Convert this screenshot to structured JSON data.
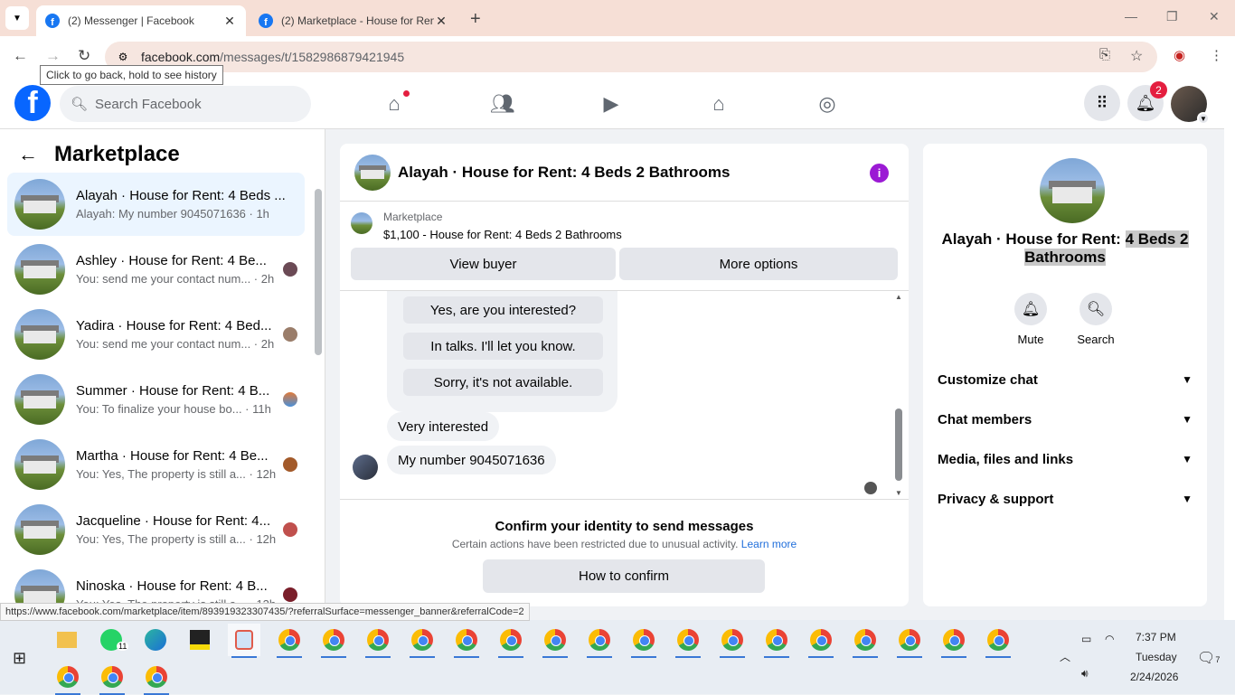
{
  "browser": {
    "tabs": [
      {
        "title": "(2) Messenger | Facebook",
        "active": true
      },
      {
        "title": "(2) Marketplace - House for Ren",
        "active": false
      }
    ],
    "url_host": "facebook.com",
    "url_path": "/messages/t/1582986879421945",
    "tooltip": "Click to go back, hold to see history",
    "status_url": "https://www.facebook.com/marketplace/item/893919323307435/?referralSurface=messenger_banner&referralCode=2"
  },
  "fb_header": {
    "search_placeholder": "Search Facebook",
    "notification_count": "2"
  },
  "sidebar": {
    "title": "Marketplace",
    "conversations": [
      {
        "name": "Alayah · House for Rent: 4 Beds ...",
        "preview": "Alayah: My number 9045071636 · 1h",
        "active": true
      },
      {
        "name": "Ashley · House for Rent: 4 Be...",
        "preview": "You: send me your contact num... · 2h",
        "active": false
      },
      {
        "name": "Yadira · House for Rent: 4 Bed...",
        "preview": "You: send me your contact num... · 2h",
        "active": false
      },
      {
        "name": "Summer · House for Rent: 4 B...",
        "preview": "You: To finalize your house bo... · 11h",
        "active": false
      },
      {
        "name": "Martha · House for Rent: 4 Be...",
        "preview": "You: Yes, The property is still a... · 12h",
        "active": false
      },
      {
        "name": "Jacqueline · House for Rent: 4...",
        "preview": "You: Yes, The property is still a... · 12h",
        "active": false
      },
      {
        "name": "Ninoska · House for Rent: 4 B...",
        "preview": "You: Yes, The property is still a... · 12h",
        "active": false
      }
    ]
  },
  "chat": {
    "title": "Alayah · House for Rent: 4 Beds 2 Bathrooms",
    "listing_label": "Marketplace",
    "listing_title": "$1,100 - House for Rent: 4 Beds 2 Bathrooms",
    "view_buyer": "View buyer",
    "more_options": "More options",
    "quick_replies": [
      "Yes, are you interested?",
      "In talks. I'll let you know.",
      "Sorry, it's not available."
    ],
    "messages": [
      "Very interested",
      "My number 9045071636"
    ],
    "confirm_heading": "Confirm your identity to send messages",
    "confirm_text": "Certain actions have been restricted due to unusual activity.",
    "learn_more": "Learn more",
    "how_to_confirm": "How to confirm"
  },
  "info_panel": {
    "name_plain": "Alayah · House for Rent: ",
    "name_highlight": "4 Beds 2 Bathrooms",
    "mute": "Mute",
    "search": "Search",
    "sections": [
      "Customize chat",
      "Chat members",
      "Media, files and links",
      "Privacy & support"
    ]
  },
  "taskbar": {
    "whatsapp_badge": "11",
    "time": "7:37 PM",
    "day": "Tuesday",
    "date": "2/24/2026",
    "notif_count": "7"
  }
}
